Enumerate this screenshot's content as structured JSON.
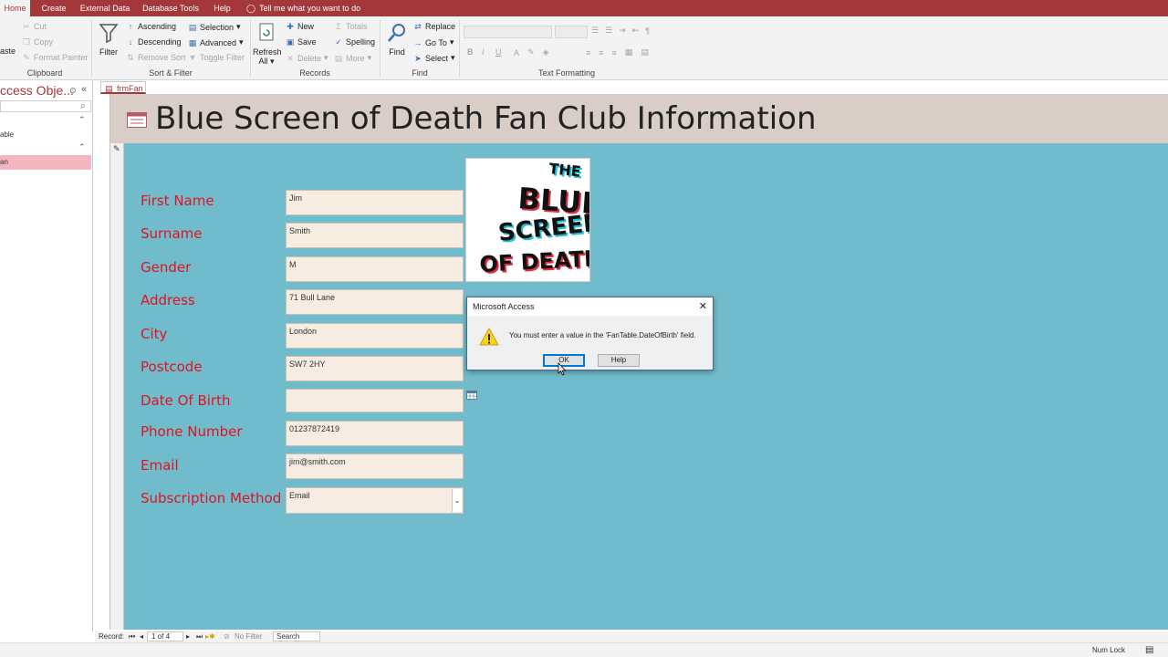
{
  "menu_tabs": [
    "Home",
    "Create",
    "External Data",
    "Database Tools",
    "Help"
  ],
  "tell_me": "Tell me what you want to do",
  "ribbon": {
    "clipboard": {
      "paste": "aste",
      "cut": "Cut",
      "copy": "Copy",
      "format_painter": "Format Painter",
      "label": "Clipboard"
    },
    "sort_filter": {
      "filter": "Filter",
      "ascending": "Ascending",
      "descending": "Descending",
      "remove_sort": "Remove Sort",
      "selection": "Selection",
      "advanced": "Advanced",
      "toggle_filter": "Toggle Filter",
      "label": "Sort & Filter"
    },
    "records": {
      "refresh": "Refresh",
      "refresh_sub": "All",
      "new": "New",
      "save": "Save",
      "delete": "Delete",
      "totals": "Totals",
      "spelling": "Spelling",
      "more": "More",
      "label": "Records"
    },
    "find": {
      "find": "Find",
      "replace": "Replace",
      "goto": "Go To",
      "select": "Select",
      "label": "Find"
    },
    "text_formatting": {
      "label": "Text Formatting",
      "bold": "B",
      "italic": "I",
      "underline": "U"
    }
  },
  "nav_pane": {
    "title": "ccess Obje...",
    "item1": "able",
    "item2": "an"
  },
  "doc_tab": "frmFan",
  "form": {
    "title": "Blue Screen of Death Fan Club Information",
    "fields": [
      {
        "label": "First Name",
        "value": "Jim"
      },
      {
        "label": "Surname",
        "value": "Smith"
      },
      {
        "label": "Gender",
        "value": "M"
      },
      {
        "label": "Address",
        "value": "71 Bull Lane"
      },
      {
        "label": "City",
        "value": "London"
      },
      {
        "label": "Postcode",
        "value": "SW7 2HY"
      },
      {
        "label": "Date Of Birth",
        "value": ""
      },
      {
        "label": "Phone Number",
        "value": "01237872419"
      },
      {
        "label": "Email",
        "value": "jim@smith.com"
      },
      {
        "label": "Subscription Method",
        "value": "Email"
      }
    ],
    "logo_text": [
      "THE",
      "BLUE",
      "SCREEN",
      "OF DEATH"
    ]
  },
  "record_bar": {
    "record_label": "Record:",
    "position": "1 of 4",
    "filter": "No Filter",
    "search": "Search"
  },
  "status_bar": {
    "num_lock": "Num Lock"
  },
  "dialog": {
    "title": "Microsoft Access",
    "message": "You must enter a value in the 'FanTable.DateOfBirth' field.",
    "ok": "OK",
    "help": "Help"
  },
  "colors": {
    "accent": "#a4373a",
    "form_bg": "#71bccc",
    "label": "#e0131f",
    "field_bg": "#f6ece2",
    "header_bg": "#d9cdc8"
  }
}
